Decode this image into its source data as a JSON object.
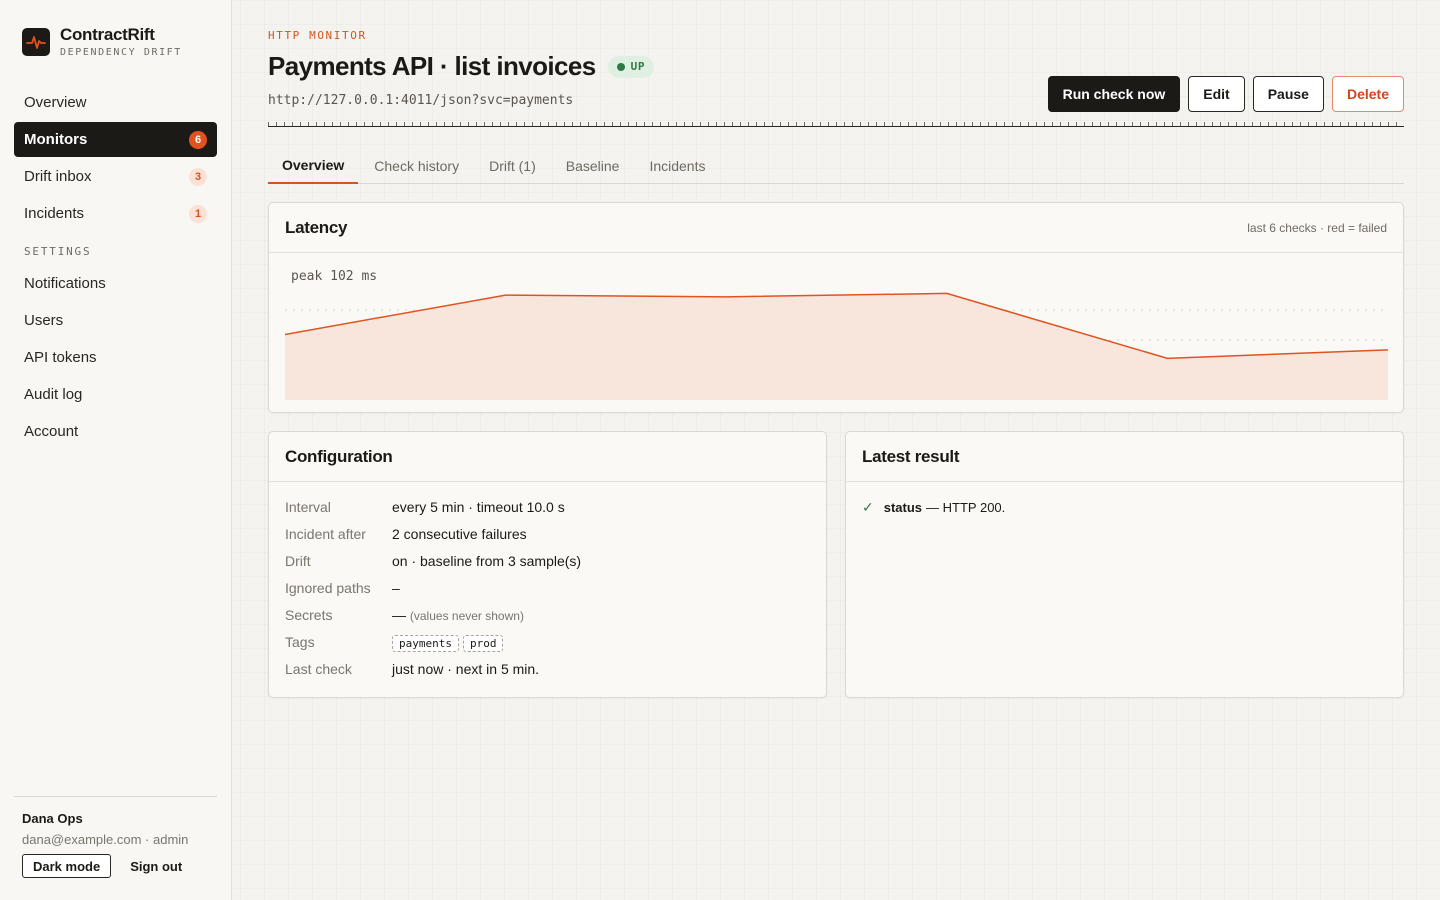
{
  "brand": {
    "name": "ContractRift",
    "subtitle": "DEPENDENCY DRIFT"
  },
  "sidebar": {
    "items": [
      {
        "label": "Overview",
        "badge": ""
      },
      {
        "label": "Monitors",
        "badge": "6"
      },
      {
        "label": "Drift inbox",
        "badge": "3"
      },
      {
        "label": "Incidents",
        "badge": "1"
      }
    ],
    "settings_heading": "SETTINGS",
    "settings_items": [
      {
        "label": "Notifications"
      },
      {
        "label": "Users"
      },
      {
        "label": "API tokens"
      },
      {
        "label": "Audit log"
      },
      {
        "label": "Account"
      }
    ]
  },
  "user": {
    "name": "Dana Ops",
    "meta": "dana@example.com · admin",
    "dark_mode_label": "Dark mode",
    "sign_out_label": "Sign out"
  },
  "header": {
    "eyebrow": "HTTP MONITOR",
    "title": "Payments API · list invoices",
    "status": "UP",
    "url": "http://127.0.0.1:4011/json?svc=payments"
  },
  "actions": {
    "run": "Run check now",
    "edit": "Edit",
    "pause": "Pause",
    "delete": "Delete"
  },
  "tabs": [
    "Overview",
    "Check history",
    "Drift (1)",
    "Baseline",
    "Incidents"
  ],
  "latency": {
    "title": "Latency",
    "note": "last 6 checks · red = failed",
    "peak_label": "peak 102 ms",
    "values": [
      76,
      99,
      98,
      100,
      62,
      67
    ],
    "peak": 102
  },
  "config": {
    "title": "Configuration",
    "rows": {
      "interval": {
        "label": "Interval",
        "value": "every 5 min · timeout 10.0 s"
      },
      "incident": {
        "label": "Incident after",
        "value": "2 consecutive failures"
      },
      "drift": {
        "label": "Drift",
        "value": "on · baseline from 3 sample(s)"
      },
      "ignored": {
        "label": "Ignored paths",
        "value": "–"
      },
      "secrets": {
        "label": "Secrets",
        "value": "—",
        "note": "(values never shown)"
      },
      "tags": {
        "label": "Tags",
        "values": [
          "payments",
          "prod"
        ]
      },
      "last": {
        "label": "Last check",
        "value": "just now · next in 5 min."
      }
    }
  },
  "latest": {
    "title": "Latest result",
    "key": "status",
    "text": "— HTTP 200."
  },
  "colors": {
    "accent": "#d2541f",
    "line": "#e0531f",
    "fill": "#f8e6dc",
    "ok": "#2c7a44"
  }
}
